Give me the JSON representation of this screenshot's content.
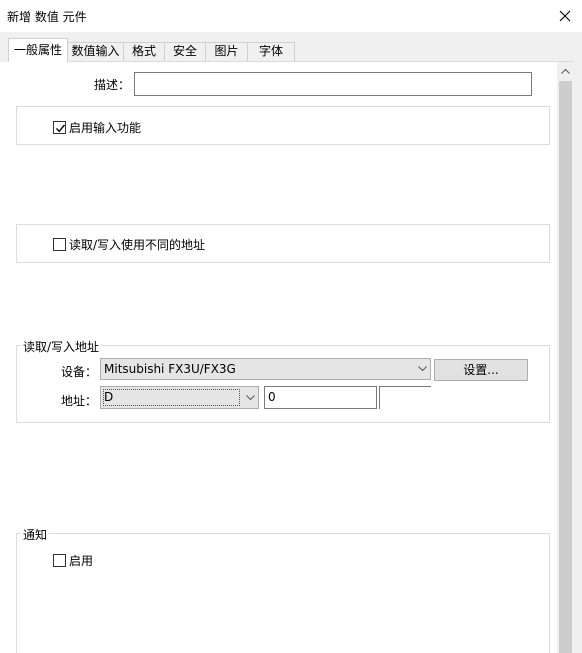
{
  "window": {
    "title": "新增 数值 元件",
    "close_glyph": "×"
  },
  "tabs": [
    {
      "label": "一般属性",
      "active": true
    },
    {
      "label": "数值输入",
      "active": false
    },
    {
      "label": "格式",
      "active": false
    },
    {
      "label": "安全",
      "active": false
    },
    {
      "label": "图片",
      "active": false
    },
    {
      "label": "字体",
      "active": false
    }
  ],
  "description": {
    "label": "描述：",
    "value": ""
  },
  "enable_input": {
    "label": "启用输入功能",
    "checked": true
  },
  "rw_different": {
    "label": "读取/写入使用不同的地址",
    "checked": false
  },
  "rw_address": {
    "legend": "读取/写入地址",
    "device_label": "设备：",
    "device_value": "Mitsubishi FX3U/FX3G",
    "settings_button": "设置...",
    "address_label": "地址：",
    "address_type": "D",
    "address_value": "0"
  },
  "notify": {
    "legend": "通知",
    "enable_label": "启用",
    "checked": false
  },
  "colors": {
    "window_bg": "#ffffff",
    "tab_strip_bg": "#f0f0f0",
    "combo_bg": "#e5e5e5",
    "button_bg": "#e1e1e1",
    "group_border": "#dcdcdc"
  }
}
